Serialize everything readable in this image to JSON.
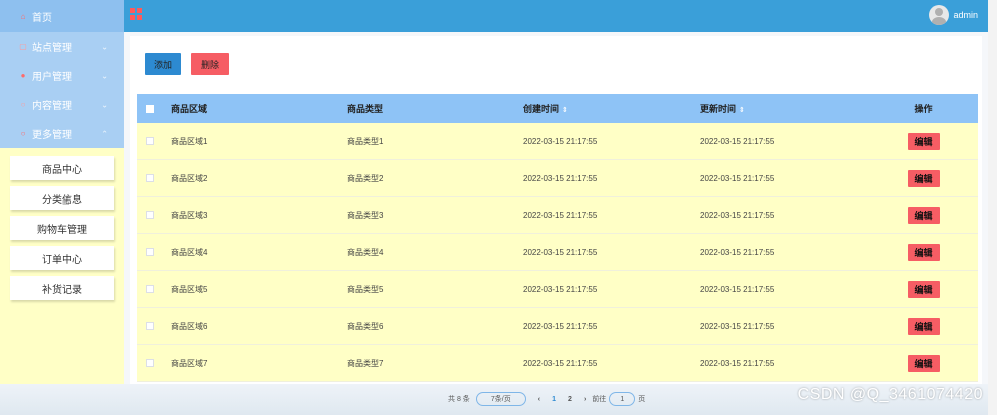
{
  "sidebar": {
    "home": "首页",
    "menus": [
      {
        "label": "站点管理",
        "icon": "site-icon"
      },
      {
        "label": "用户管理",
        "icon": "user-icon"
      },
      {
        "label": "内容管理",
        "icon": "content-icon"
      },
      {
        "label": "更多管理",
        "icon": "more-icon"
      }
    ],
    "submenu": [
      "商品中心",
      "分类信息",
      "购物车管理",
      "订单中心",
      "补货记录"
    ]
  },
  "topbar": {
    "username": "admin"
  },
  "toolbar": {
    "add_label": "添加",
    "delete_label": "删除"
  },
  "table": {
    "headers": {
      "area": "商品区域",
      "type": "商品类型",
      "created": "创建时间",
      "updated": "更新时间",
      "op": "操作"
    },
    "rows": [
      {
        "area": "商品区域1",
        "type": "商品类型1",
        "created": "2022-03-15 21:17:55",
        "updated": "2022-03-15 21:17:55",
        "op": "编辑"
      },
      {
        "area": "商品区域2",
        "type": "商品类型2",
        "created": "2022-03-15 21:17:55",
        "updated": "2022-03-15 21:17:55",
        "op": "编辑"
      },
      {
        "area": "商品区域3",
        "type": "商品类型3",
        "created": "2022-03-15 21:17:55",
        "updated": "2022-03-15 21:17:55",
        "op": "编辑"
      },
      {
        "area": "商品区域4",
        "type": "商品类型4",
        "created": "2022-03-15 21:17:55",
        "updated": "2022-03-15 21:17:55",
        "op": "编辑"
      },
      {
        "area": "商品区域5",
        "type": "商品类型5",
        "created": "2022-03-15 21:17:55",
        "updated": "2022-03-15 21:17:55",
        "op": "编辑"
      },
      {
        "area": "商品区域6",
        "type": "商品类型6",
        "created": "2022-03-15 21:17:55",
        "updated": "2022-03-15 21:17:55",
        "op": "编辑"
      },
      {
        "area": "商品区域7",
        "type": "商品类型7",
        "created": "2022-03-15 21:17:55",
        "updated": "2022-03-15 21:17:55",
        "op": "编辑"
      }
    ]
  },
  "pagination": {
    "total": "共 8 条",
    "page_size": "7条/页",
    "prev": "‹",
    "pages": [
      "1",
      "2"
    ],
    "next": "›",
    "goto": "前往",
    "goto_value": "1",
    "page_unit": "页"
  },
  "watermark": "CSDN @Q_3461074420",
  "colors": {
    "topbar": "#3a9fd9",
    "sidebar_menu": "#a9cff3",
    "table_header": "#8ec3f6",
    "row_bg": "#ffffc6",
    "danger": "#f65d64",
    "primary": "#2d8ad1"
  }
}
